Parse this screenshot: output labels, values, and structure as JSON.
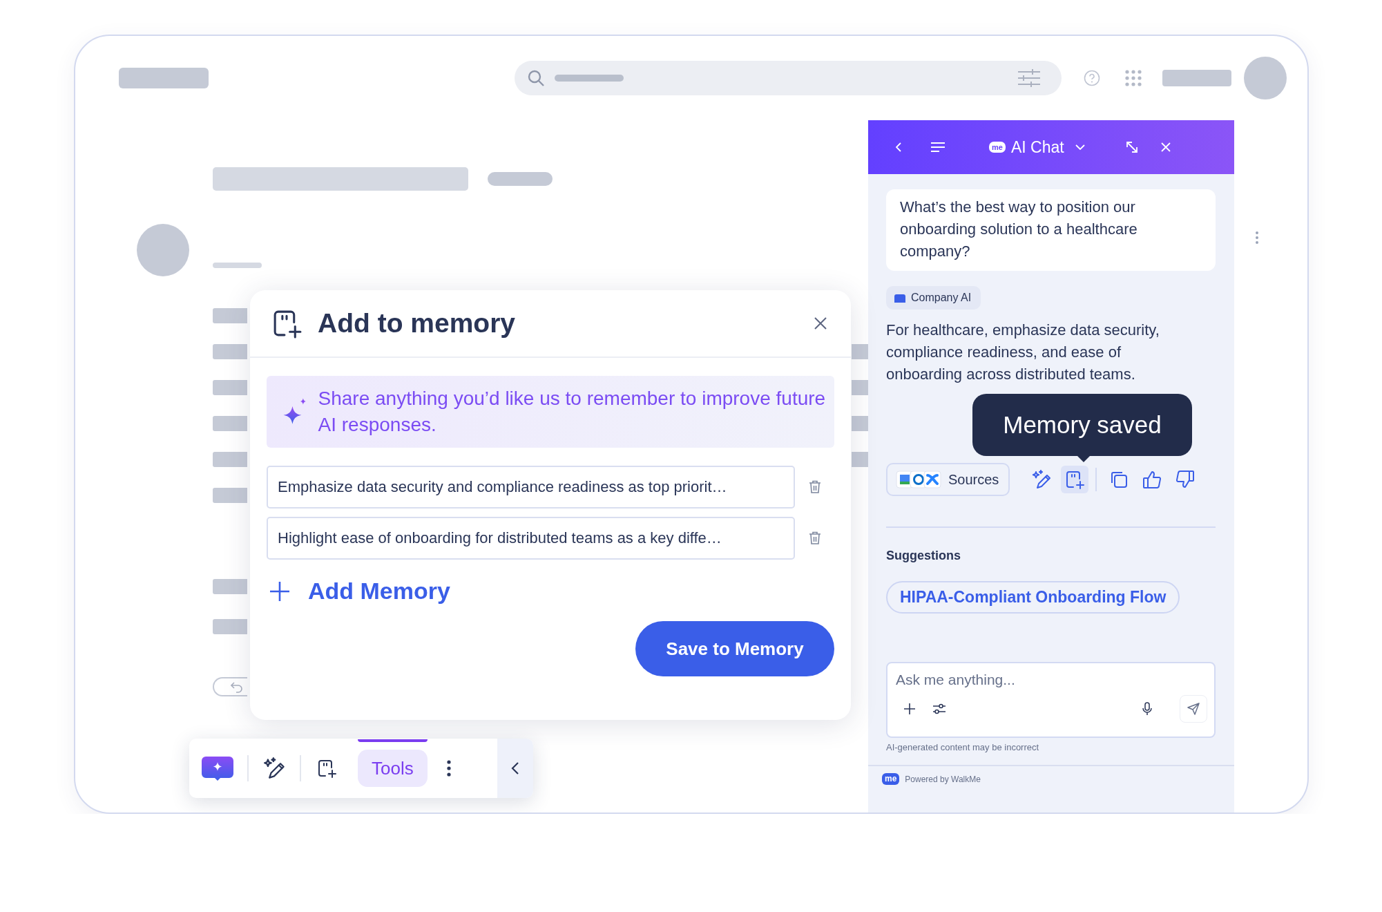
{
  "memory_dialog": {
    "title": "Add to memory",
    "banner": "Share anything you’d like us to remember to improve future AI responses.",
    "memories": [
      "Emphasize data security and compliance readiness as top priorit…",
      "Highlight ease of onboarding for distributed teams as a key diffe…"
    ],
    "add_label": "Add Memory",
    "save_label": "Save to Memory"
  },
  "toolbar": {
    "tabs": [
      {
        "label": "Tools",
        "selected": true
      }
    ]
  },
  "chat": {
    "logo_text": "me",
    "title": "AI Chat",
    "question": "What’s the best way to position our onboarding solution to a healthcare company?",
    "source_label": "Company AI",
    "answer": "For healthcare, emphasize data security, compliance readiness, and ease of onboarding across distributed teams.",
    "sources_label": "Sources",
    "tooltip": "Memory saved",
    "actions": [
      {
        "kind": "magic",
        "selected": false
      },
      {
        "kind": "memory",
        "selected": true
      },
      {
        "kind": "copy",
        "selected": false
      },
      {
        "kind": "like",
        "selected": false
      },
      {
        "kind": "dislike",
        "selected": false
      }
    ],
    "suggestions_label": "Suggestions",
    "suggestions": [
      "HIPAA-Compliant Onboarding Flow"
    ],
    "input": {
      "placeholder": "Ask me anything..."
    },
    "disclaimer": "AI-generated content may be incorrect",
    "footer_logo": "me",
    "footer": "Powered by WalkMe"
  }
}
